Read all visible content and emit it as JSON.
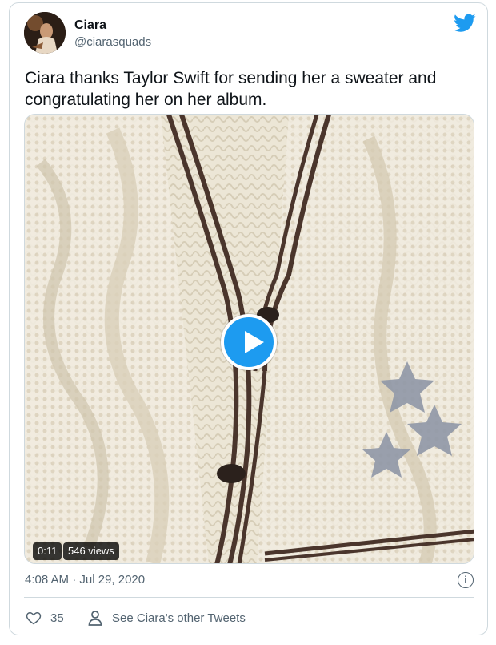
{
  "author": {
    "name": "Ciara",
    "handle": "@ciarasquads"
  },
  "tweet": {
    "text": "Ciara thanks Taylor Swift for sending her a sweater and congratulating her on her album.",
    "timestamp": "4:08 AM · Jul 29, 2020"
  },
  "media": {
    "type": "video",
    "duration": "0:11",
    "views": "546 views"
  },
  "actions": {
    "like_count": "35",
    "see_other": "See Ciara's other Tweets"
  },
  "icons": [
    "twitter-bird-icon",
    "play-icon",
    "info-icon",
    "heart-icon",
    "person-icon"
  ],
  "colors": {
    "accent": "#1d9bf0",
    "text": "#0f1419",
    "secondary_text": "#536471",
    "border": "#cfd9de"
  }
}
